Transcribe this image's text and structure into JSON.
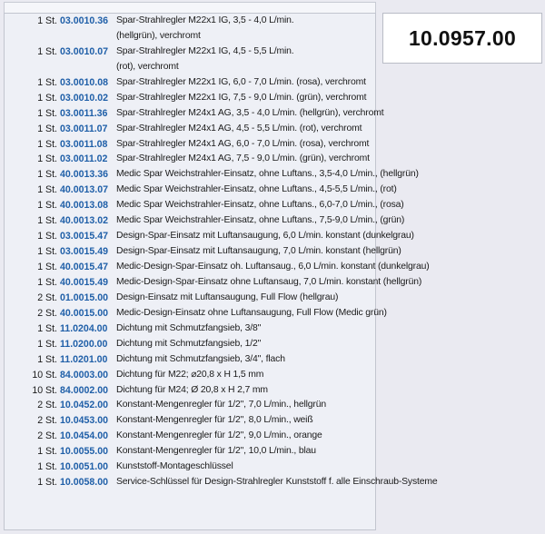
{
  "article_number": "10.0957.00",
  "items": [
    {
      "qty": "1 St.",
      "code": "03.0010.36",
      "desc": "Spar-Strahlregler M22x1 IG, 3,5 - 4,0 L/min."
    },
    {
      "qty": "",
      "code": "",
      "desc": "(hellgrün), verchromt"
    },
    {
      "qty": "1 St.",
      "code": "03.0010.07",
      "desc": "Spar-Strahlregler M22x1 IG, 4,5 - 5,5 L/min."
    },
    {
      "qty": "",
      "code": "",
      "desc": "(rot), verchromt"
    },
    {
      "qty": "1 St.",
      "code": "03.0010.08",
      "desc": "Spar-Strahlregler M22x1 IG, 6,0 - 7,0 L/min. (rosa), verchromt"
    },
    {
      "qty": "1 St.",
      "code": "03.0010.02",
      "desc": "Spar-Strahlregler M22x1 IG, 7,5 - 9,0 L/min. (grün), verchromt"
    },
    {
      "qty": "1 St.",
      "code": "03.0011.36",
      "desc": "Spar-Strahlregler M24x1 AG, 3,5 - 4,0 L/min. (hellgrün), verchromt"
    },
    {
      "qty": "1 St.",
      "code": "03.0011.07",
      "desc": "Spar-Strahlregler M24x1 AG, 4,5 - 5,5 L/min. (rot), verchromt"
    },
    {
      "qty": "1 St.",
      "code": "03.0011.08",
      "desc": "Spar-Strahlregler M24x1 AG, 6,0 - 7,0 L/min. (rosa), verchromt"
    },
    {
      "qty": "1 St.",
      "code": "03.0011.02",
      "desc": "Spar-Strahlregler M24x1 AG, 7,5 - 9,0 L/min. (grün), verchromt"
    },
    {
      "qty": "1 St.",
      "code": "40.0013.36",
      "desc": "Medic Spar Weichstrahler-Einsatz, ohne Luftans., 3,5-4,0 L/min., (hellgrün)"
    },
    {
      "qty": "1 St.",
      "code": "40.0013.07",
      "desc": "Medic Spar Weichstrahler-Einsatz, ohne Luftans., 4,5-5,5 L/min., (rot)"
    },
    {
      "qty": "1 St.",
      "code": "40.0013.08",
      "desc": "Medic Spar Weichstrahler-Einsatz, ohne Luftans., 6,0-7,0 L/min., (rosa)"
    },
    {
      "qty": "1 St.",
      "code": "40.0013.02",
      "desc": "Medic Spar Weichstrahler-Einsatz, ohne Luftans., 7,5-9,0 L/min., (grün)"
    },
    {
      "qty": "1 St.",
      "code": "03.0015.47",
      "desc": "Design-Spar-Einsatz mit Luftansaugung, 6,0 L/min. konstant (dunkelgrau)"
    },
    {
      "qty": "1 St.",
      "code": "03.0015.49",
      "desc": "Design-Spar-Einsatz mit Luftansaugung, 7,0 L/min. konstant (hellgrün)"
    },
    {
      "qty": "1 St.",
      "code": "40.0015.47",
      "desc": "Medic-Design-Spar-Einsatz oh. Luftansaug., 6,0 L/min. konstant (dunkelgrau)"
    },
    {
      "qty": "1 St.",
      "code": "40.0015.49",
      "desc": "Medic-Design-Spar-Einsatz ohne Luftansaug, 7,0 L/min. konstant (hellgrün)"
    },
    {
      "qty": "2 St.",
      "code": "01.0015.00",
      "desc": "Design-Einsatz mit Luftansaugung, Full Flow (hellgrau)"
    },
    {
      "qty": "2 St.",
      "code": "40.0015.00",
      "desc": "Medic-Design-Einsatz ohne Luftansaugung, Full Flow (Medic grün)"
    },
    {
      "qty": "1 St.",
      "code": "11.0204.00",
      "desc": "Dichtung mit Schmutzfangsieb, 3/8\""
    },
    {
      "qty": "1 St.",
      "code": "11.0200.00",
      "desc": "Dichtung mit Schmutzfangsieb, 1/2\""
    },
    {
      "qty": "1 St.",
      "code": "11.0201.00",
      "desc": "Dichtung mit Schmutzfangsieb, 3/4\", flach"
    },
    {
      "qty": "10 St.",
      "code": "84.0003.00",
      "desc": "Dichtung für M22; ⌀20,8 x H 1,5 mm"
    },
    {
      "qty": "10 St.",
      "code": "84.0002.00",
      "desc": "Dichtung für M24; Ø 20,8 x H 2,7 mm"
    },
    {
      "qty": "2 St.",
      "code": "10.0452.00",
      "desc": "Konstant-Mengenregler für 1/2\", 7,0 L/min., hellgrün"
    },
    {
      "qty": "2 St.",
      "code": "10.0453.00",
      "desc": "Konstant-Mengenregler für 1/2\", 8,0 L/min., weiß"
    },
    {
      "qty": "2 St.",
      "code": "10.0454.00",
      "desc": "Konstant-Mengenregler für 1/2\", 9,0 L/min., orange"
    },
    {
      "qty": "1 St.",
      "code": "10.0055.00",
      "desc": "Konstant-Mengenregler für 1/2\", 10,0 L/min., blau"
    },
    {
      "qty": "1 St.",
      "code": "10.0051.00",
      "desc": "Kunststoff-Montageschlüssel"
    },
    {
      "qty": "1 St.",
      "code": "10.0058.00",
      "desc": "Service-Schlüssel für Design-Strahlregler Kunststoff f. alle Einschraub-Systeme"
    }
  ]
}
